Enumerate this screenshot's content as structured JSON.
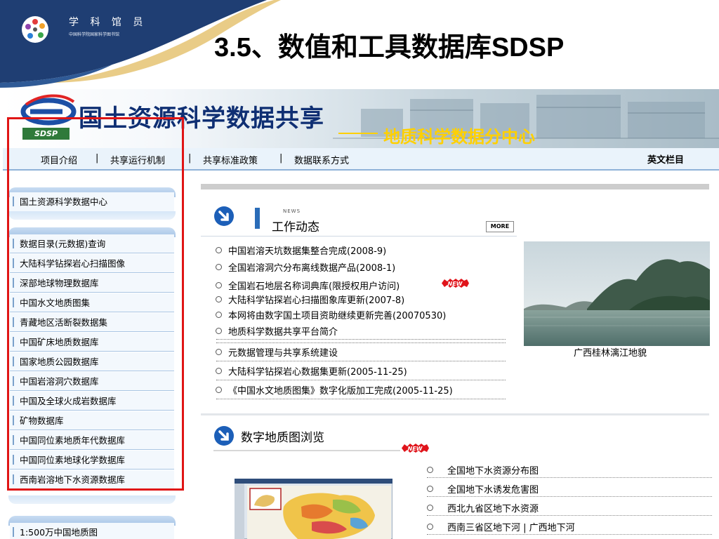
{
  "slide": {
    "brand_title": "学 科 馆 员",
    "brand_sub": "中国科学院国家科学图书馆",
    "title": "3.5、数值和工具数据库SDSP"
  },
  "site": {
    "name": "国土资源科学数据共享",
    "sub_center": "地质科学数据分中心",
    "logo_text": "SDSP",
    "nav": [
      {
        "label": "项目介绍"
      },
      {
        "label": "共享运行机制"
      },
      {
        "label": "共享标准政策"
      },
      {
        "label": "数据联系方式"
      }
    ],
    "nav_sep": "|",
    "nav_en": "英文栏目",
    "sidebar_top": "国土资源科学数据中心",
    "sidebar_items": [
      "数据目录(元数据)查询",
      "大陆科学钻探岩心扫描图像",
      "深部地球物理数据库",
      "中国水文地质图集",
      "青藏地区活断裂数据集",
      "中国矿床地质数据库",
      "国家地质公园数据库",
      "中国岩溶洞穴数据库",
      "中国及全球火成岩数据库",
      "矿物数据库",
      "中国同位素地质年代数据库",
      "中国同位素地球化学数据库",
      "西南岩溶地下水资源数据库"
    ],
    "sidebar_bottom": "1:500万中国地质图",
    "news": {
      "label_small": "NEWS",
      "title": "工作动态",
      "more": "MORE",
      "new_badge": "NEW",
      "items": [
        "中国岩溶天坑数据集整合完成(2008-9)",
        "全国岩溶洞穴分布离线数据产品(2008-1)",
        "全国岩石地层名称词典库(限授权用户访问)",
        "大陆科学钻探岩心扫描图象库更新(2007-8)",
        "本网将由数字国土项目资助继续更新完善(20070530)",
        "地质科学数据共享平台简介",
        "元数据管理与共享系统建设",
        "大陆科学钻探岩心数据集更新(2005-11-25)",
        "《中国水文地质图集》数字化版加工完成(2005-11-25)"
      ]
    },
    "photo_caption": "广西桂林漓江地貌",
    "map_section": {
      "title": "数字地质图浏览",
      "new_badge": "NEW",
      "items": [
        "全国地下水资源分布图",
        "全国地下水诱发危害图",
        "西北九省区地下水资源",
        "西南三省区地下河 | 广西地下河"
      ]
    }
  }
}
